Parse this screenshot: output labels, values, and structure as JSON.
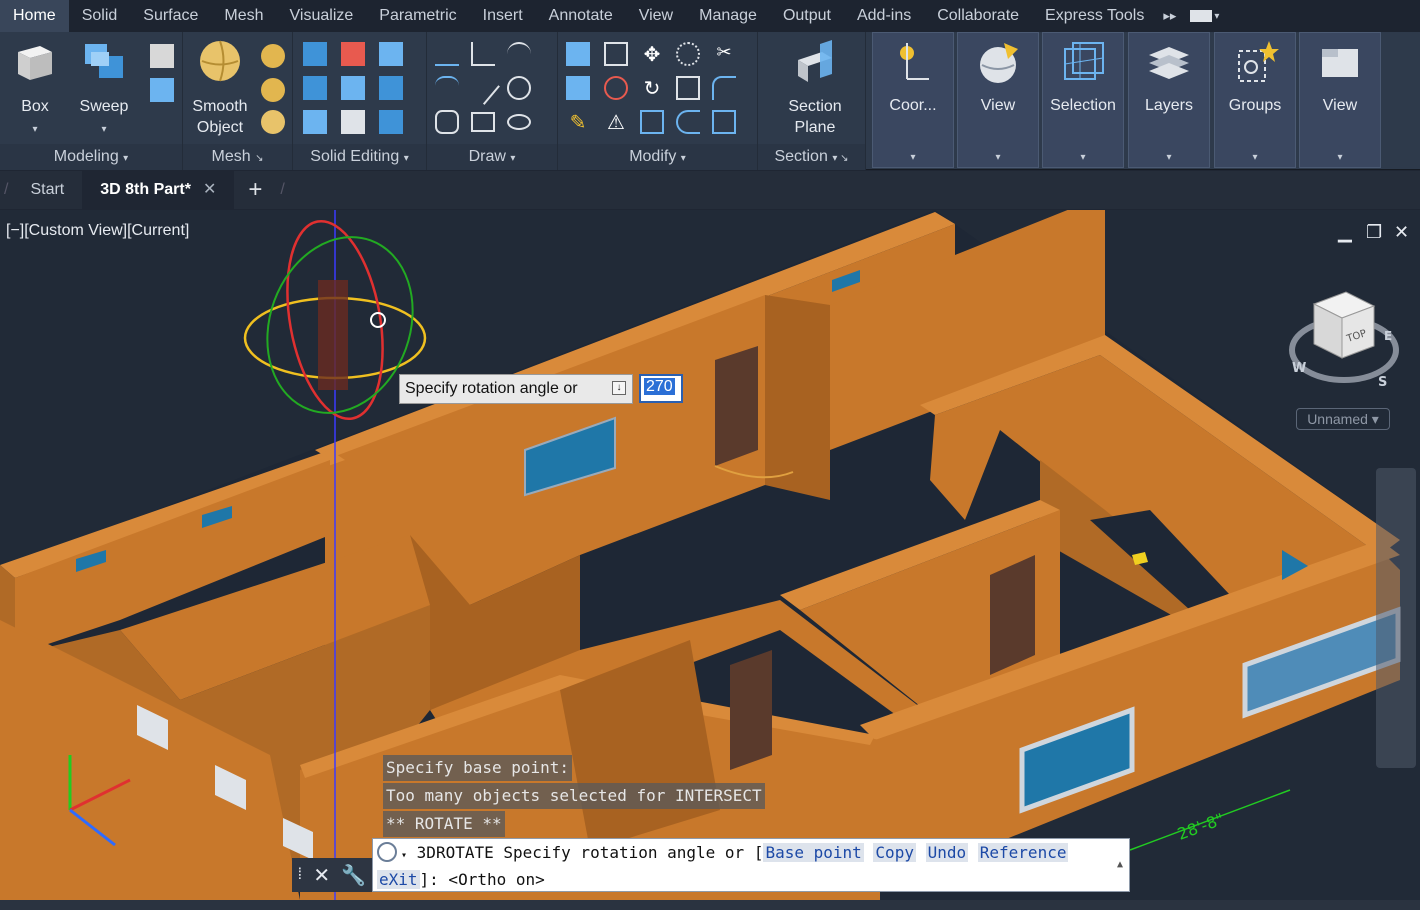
{
  "ribbon_tabs": [
    "Home",
    "Solid",
    "Surface",
    "Mesh",
    "Visualize",
    "Parametric",
    "Insert",
    "Annotate",
    "View",
    "Manage",
    "Output",
    "Add-ins",
    "Collaborate",
    "Express Tools"
  ],
  "ribbon": {
    "box_label": "Box",
    "sweep_label": "Sweep",
    "smooth_object_line1": "Smooth",
    "smooth_object_line2": "Object",
    "section_plane_line1": "Section",
    "section_plane_line2": "Plane",
    "coordinates_label": "Coor...",
    "view_label": "View",
    "selection_label": "Selection",
    "layers_label": "Layers",
    "groups_label": "Groups",
    "view2_label": "View",
    "panels": {
      "modeling": "Modeling",
      "mesh": "Mesh",
      "solid_editing": "Solid Editing",
      "draw": "Draw",
      "modify": "Modify",
      "section": "Section"
    }
  },
  "file_tabs": {
    "start": "Start",
    "active": "3D 8th Part*"
  },
  "viewport": {
    "label": "[−][Custom View][Current]",
    "tooltip": "Specify rotation angle or",
    "angle_value": "270",
    "dimension_text": "28'-8\"",
    "viewcube_top": "TOP",
    "compass": {
      "w": "W",
      "s": "S",
      "e": "E"
    },
    "ucs_unnamed": "Unnamed"
  },
  "command_history": [
    "Specify base point:",
    "Too many objects selected for INTERSECT",
    "** ROTATE **"
  ],
  "command_line": {
    "command": "3DROTATE Specify rotation angle or [",
    "options": [
      "Base point",
      "Copy",
      "Undo",
      "Reference"
    ],
    "line2_option": "eXit",
    "line2_rest": "]:  <Ortho on>"
  },
  "colors": {
    "wall": "#c8782b",
    "wall_shade": "#9c5a1c",
    "floor": "#1e2735",
    "window": "#1f77a8",
    "door": "#5a3a2c",
    "accent_blue": "#2b6fd6"
  }
}
